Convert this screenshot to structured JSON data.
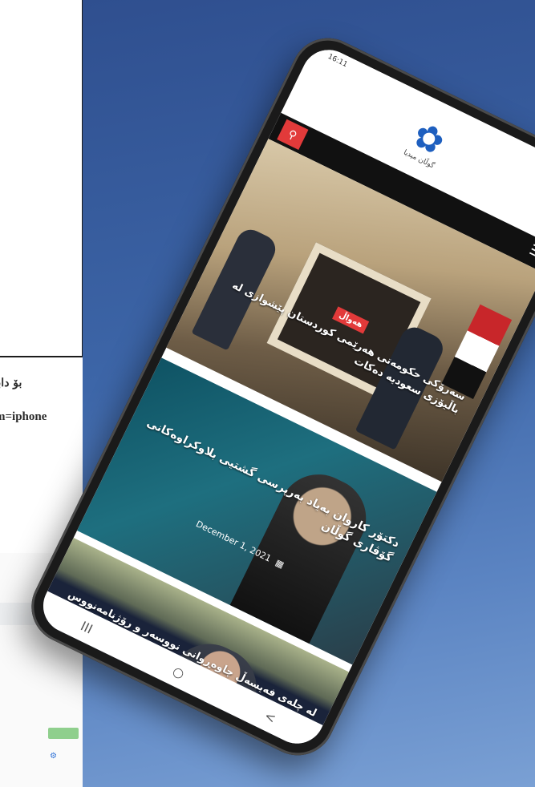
{
  "side": {
    "text_rtl": "بۆ دابەزاند",
    "text_url": "m=iphone"
  },
  "bottom_left": {
    "green_button": "",
    "logo": "⚙"
  },
  "phone": {
    "status": {
      "time": "16:11",
      "icons": "▲ ◉ ▮"
    },
    "header": {
      "logo_text": "گوڵان میدیا",
      "logo_icon": "flower-icon",
      "settings_icon": "gear-icon"
    },
    "navbar": {
      "search_icon": "search-icon",
      "menu_icon": "hamburger-icon"
    },
    "hero": {
      "badge": "هەواڵ",
      "title": "سەرۆکی حکومەتی هەرێمی کوردستان پێشوازی لە باڵیۆزی سعودیە دەکات"
    },
    "articles": [
      {
        "title": "دکتۆر کاروان بەیاد بەرپرسی گشتیی بلاوکراوەکانی گۆڤاری گوڵان",
        "date": "December 1, 2021",
        "calendar_icon": "calendar-icon"
      },
      {
        "title": "لە چلەی فەیسەڵ چاوەڕوانی نووسەر و رۆژنامەنووس ساڵ و بۆ گیانی پاکی",
        "date": "",
        "calendar_icon": "calendar-icon"
      }
    ],
    "system_nav": {
      "recent": "III",
      "home": "○",
      "back": "<"
    }
  }
}
